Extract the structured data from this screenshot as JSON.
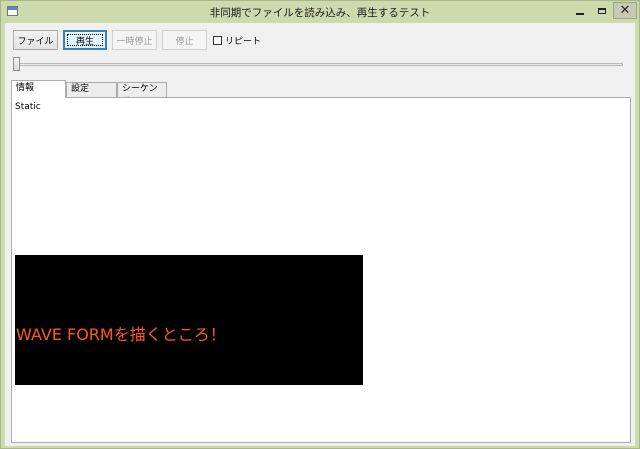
{
  "window": {
    "title": "非同期でファイルを読み込み、再生するテスト",
    "close_glyph": "✕"
  },
  "toolbar": {
    "file_label": "ファイル",
    "play_label": "再生",
    "pause_label": "一時停止",
    "stop_label": "停止",
    "repeat_label": "リピート",
    "repeat_checked": false
  },
  "seek": {
    "position": 0
  },
  "tabs": [
    {
      "label": "情報",
      "selected": true
    },
    {
      "label": "設定",
      "selected": false
    },
    {
      "label": "シーケンサ",
      "selected": false
    }
  ],
  "info_panel": {
    "static_text": "Static",
    "waveform_text": "WAVE FORMを描くところ！"
  },
  "colors": {
    "waveform_bg": "#000000",
    "waveform_text": "#ff5a14",
    "frame": "#cfd9ae"
  }
}
